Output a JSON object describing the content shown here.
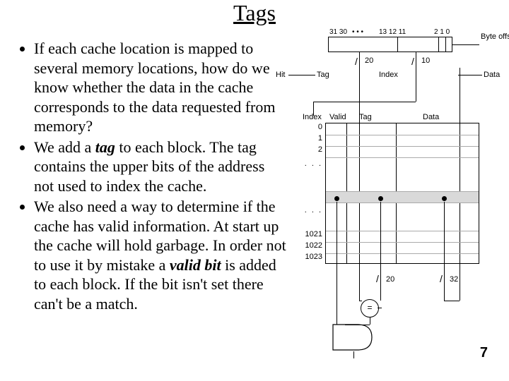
{
  "title": "Tags",
  "bullets": [
    "If each cache location is mapped to several memory locations, how do we know whether the data in the cache corresponds to the data requested from memory?",
    "We add a <span class=\"ital-bold\">tag</span> to each block. The tag contains the upper bits of the address not used to index the cache.",
    "We also need a way to determine if the cache has valid information. At start up the cache will hold garbage. In order not to use it by mistake a <span class=\"ital-bold\">valid bit</span> is added to each block. If the bit isn't set there can't be a match."
  ],
  "pageNumber": "7",
  "diagram": {
    "address_bar": {
      "bit_ticks": [
        "31 30",
        "13 12 11",
        "2 1 0"
      ],
      "dots": "• • •",
      "segments": {
        "tag_width": "20",
        "index_width": "10"
      },
      "labels": {
        "hit": "Hit",
        "tag": "Tag",
        "index": "Index",
        "byte_offset": "Byte offset",
        "data": "Data"
      }
    },
    "table": {
      "headers": {
        "index": "Index",
        "valid": "Valid",
        "tag": "Tag",
        "data": "Data"
      },
      "rows_top": [
        "0",
        "1",
        "2"
      ],
      "ellipsis": ". . .",
      "rows_bottom": [
        "1021",
        "1022",
        "1023"
      ],
      "tag_bus_width": "20",
      "data_bus_width": "32"
    },
    "comparator": "="
  }
}
